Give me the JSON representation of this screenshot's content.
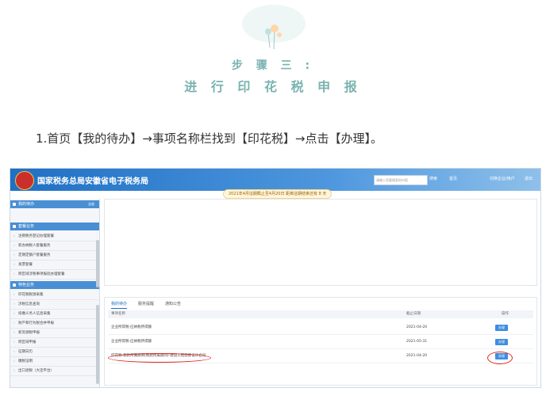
{
  "header": {
    "step_title": "步 骤 三 :",
    "step_subtitle": "进 行 印 花 税 申 报"
  },
  "instruction": "1.首页【我的待办】→事项名称栏找到【印花税】→点击【办理】。",
  "portal": {
    "site_title": "国家税务总局安徽省电子税务局",
    "search_placeholder": "请输入您要搜索的内容",
    "top_buttons": [
      "搜索",
      "首页",
      "切换企业/用户",
      "退出"
    ],
    "notice": "2021年4月征期截止至4月20日 距离征期结束还有 8 天"
  },
  "sidebar": {
    "sections": [
      {
        "title": "我的待办",
        "extra": "全部",
        "items": []
      },
      {
        "title": "套餐业务",
        "extra": "",
        "items": [
          "注销税务登记办理套餐",
          "新办纳税人套餐服务",
          "定期定额户套餐服务",
          "发票套餐",
          "跨区域涉税事项报验办理套餐"
        ]
      },
      {
        "title": "特色业务",
        "extra": "",
        "items": [
          "印花税税源采集",
          "涉税信息查询",
          "扣缴义务人信息采集",
          "财产和行为税合并申报",
          "新资源税申报",
          "跨区域申报",
          "征期日历",
          "缴税证明",
          "出口退税（大连平台）"
        ]
      }
    ]
  },
  "tabs": [
    "我的待办",
    "服务提醒",
    "通知公告"
  ],
  "table": {
    "headers": [
      "事项名称",
      "截止日期",
      "操作"
    ],
    "rows": [
      {
        "name": "企业所得税-应纳税所得额",
        "deadline": "2021-04-20",
        "action": "办理"
      },
      {
        "name": "企业所得税-应纳税所得额",
        "deadline": "2021-05-31",
        "action": "办理"
      },
      {
        "name": "印花税-税款所属期间(税款所属期间)-建设工程勘察设计合同",
        "deadline": "2021-04-20",
        "action": "办理"
      }
    ]
  },
  "colors": {
    "accent": "#1f6fc4",
    "highlight": "#e0251b",
    "heading": "#7ab3b0"
  }
}
